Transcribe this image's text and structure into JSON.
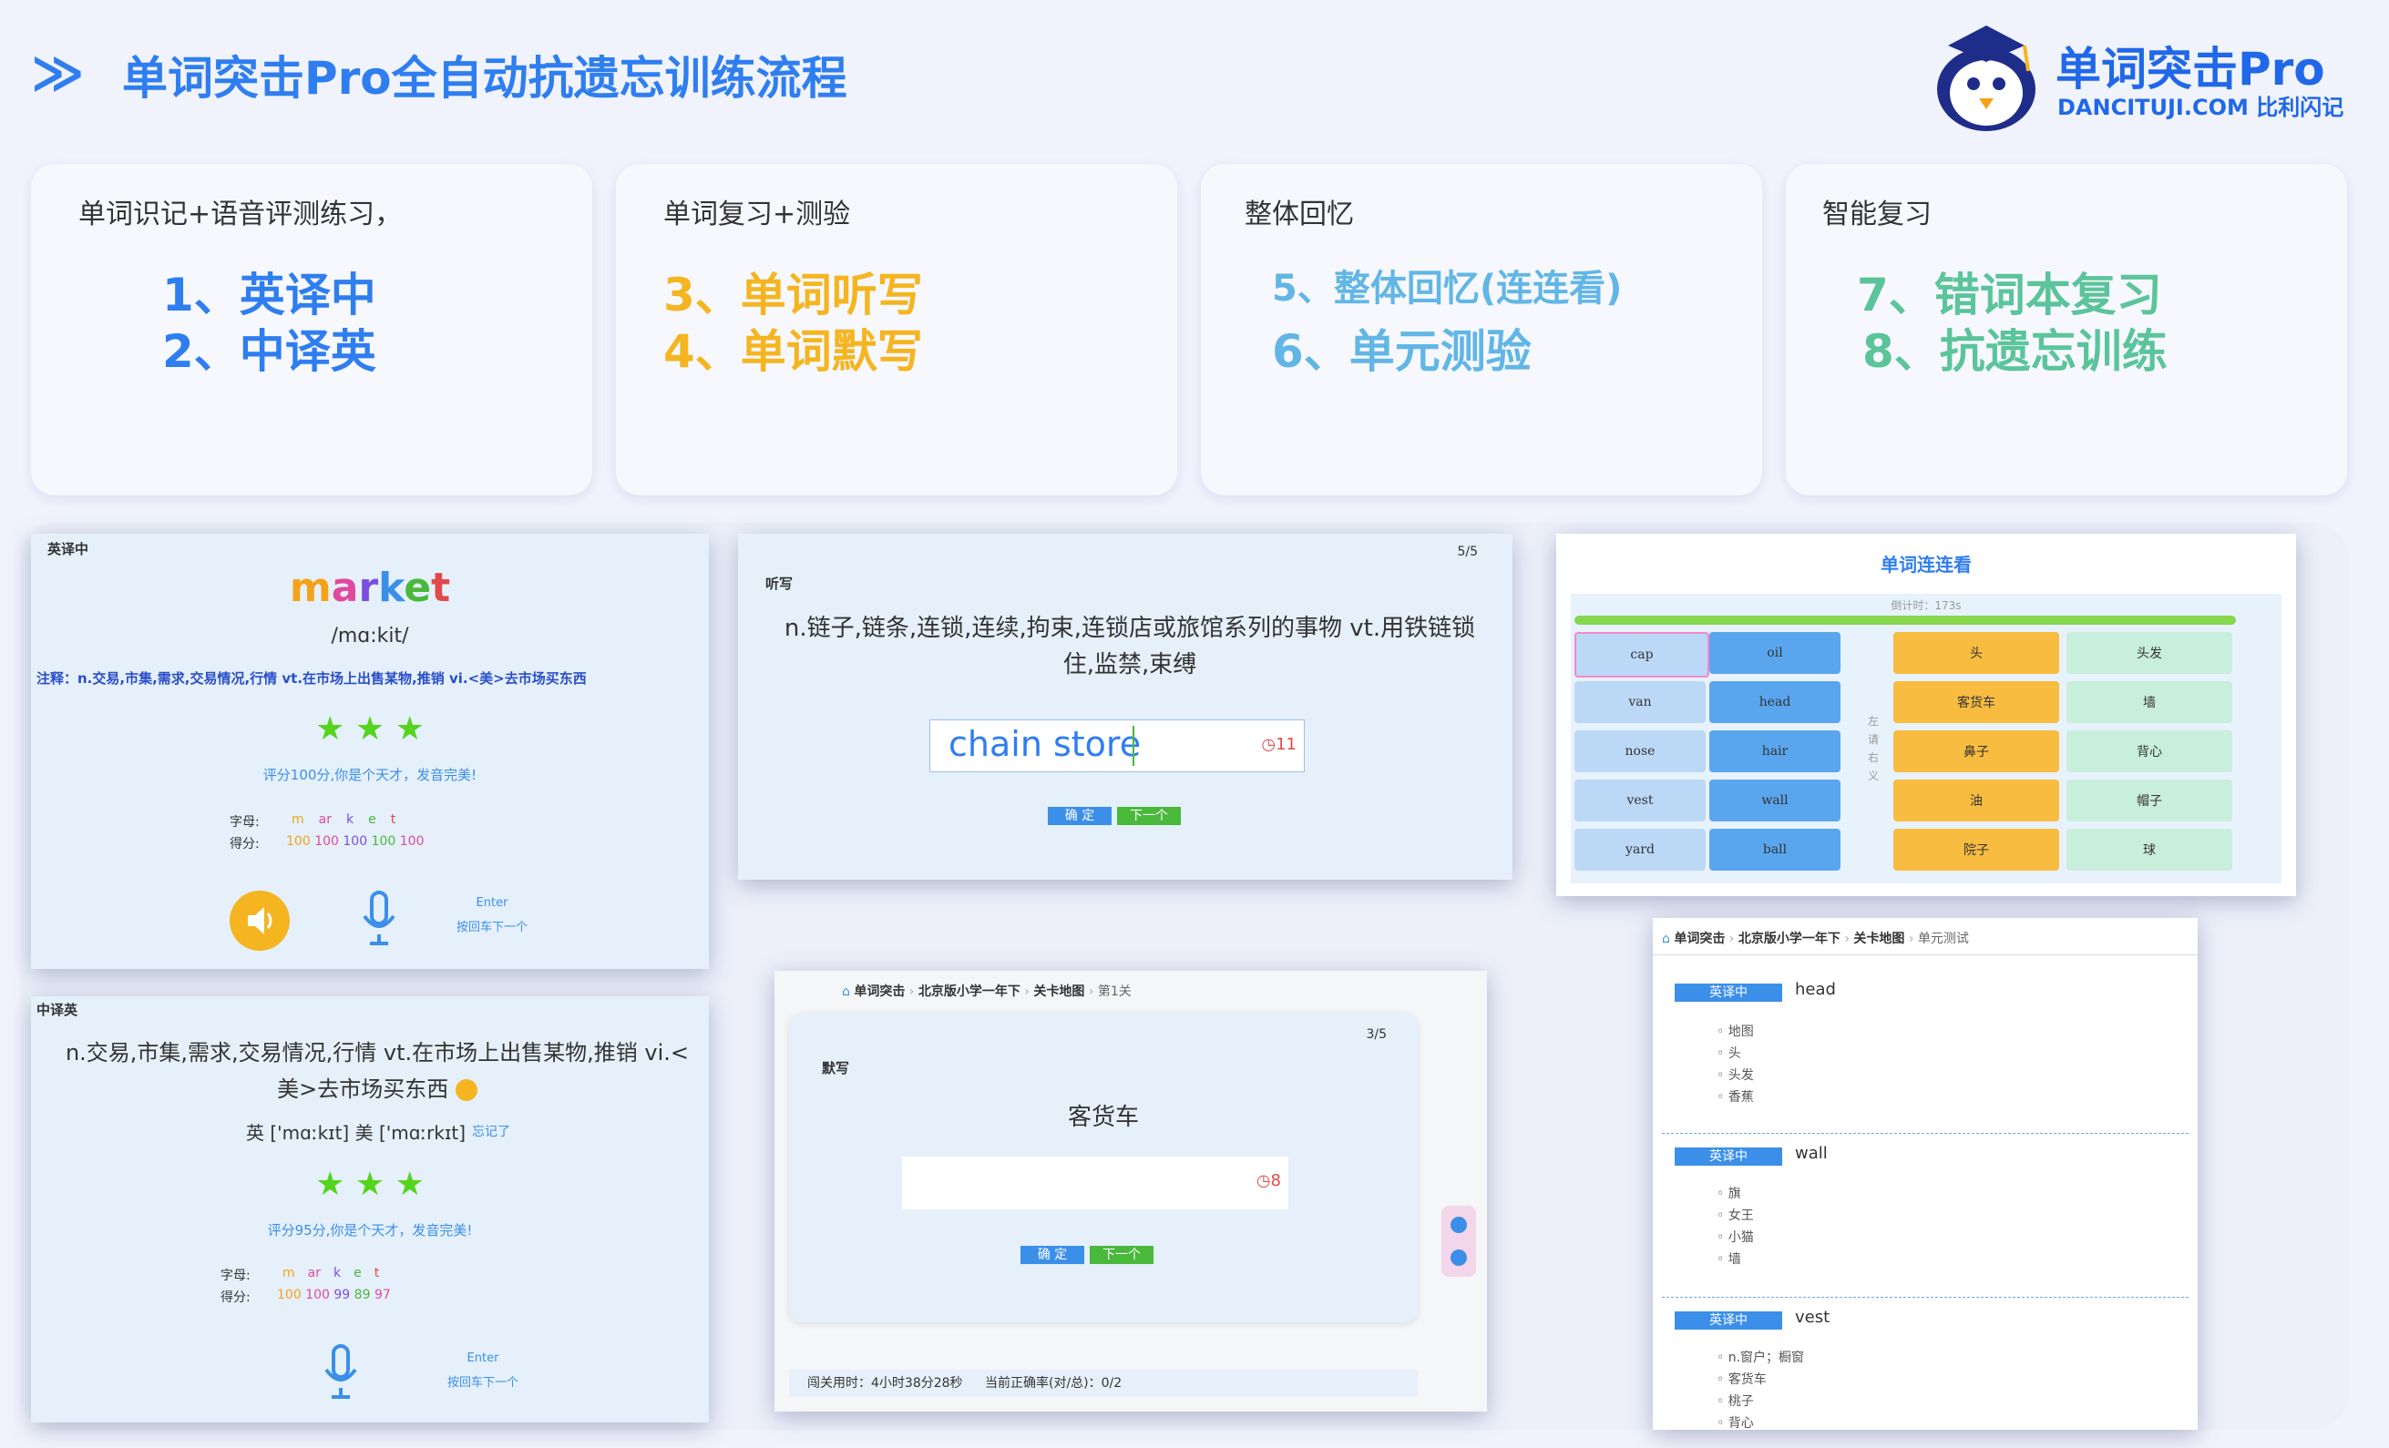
{
  "header": {
    "arrow": "≫",
    "title": "单词突击Pro全自动抗遗忘训练流程",
    "brand_main": "单词突击Pro",
    "brand_sub": "DANCITUJI.COM 比利闪记"
  },
  "colors": {
    "blue": "#2f7ef0",
    "yellow": "#f4b521",
    "sky": "#62b6e6",
    "green": "#5bc49a"
  },
  "cards": [
    {
      "title": "单词识记+语音评测练习，",
      "lines": [
        "1、英译中",
        "2、中译英"
      ]
    },
    {
      "title": "单词复习+测验",
      "lines": [
        "3、单词听写",
        "4、单词默写"
      ]
    },
    {
      "title": "整体回忆",
      "lines": [
        "5、整体回忆(连连看)",
        "6、单元测验"
      ]
    },
    {
      "title": "智能复习",
      "lines": [
        "7、错词本复习",
        "8、抗遗忘训练"
      ]
    }
  ],
  "shot_en2zh": {
    "label": "英译中",
    "word": "market",
    "phonetic": "/mɑ:kit/",
    "note": "注释：n.交易,市集,需求,交易情况,行情 vt.在市场上出售某物,推销 vi.<美>去市场买东西",
    "stars": "★ ★ ★",
    "feedback": "评分100分,你是个天才，发音完美!",
    "letters_label": "字母:",
    "letters": [
      "m",
      "ar",
      "k",
      "e",
      "t"
    ],
    "scores_label": "得分:",
    "scores": [
      "100",
      "100",
      "100",
      "100",
      "100"
    ],
    "enter": "Enter",
    "enter_hint": "按回车下一个"
  },
  "shot_zh2en": {
    "label": "中译英",
    "meaning": "n.交易,市集,需求,交易情况,行情 vt.在市场上出售某物,推销 vi.<美>去市场买东西",
    "phonetic": "英 ['mɑːkɪt] 美 ['mɑːrkɪt]",
    "forgot": "忘记了",
    "stars": "★ ★ ★",
    "feedback": "评分95分,你是个天才，发音完美!",
    "letters_label": "字母:",
    "letters": [
      "m",
      "ar",
      "k",
      "e",
      "t"
    ],
    "scores_label": "得分:",
    "scores": [
      "100",
      "100",
      "99",
      "89",
      "97"
    ],
    "enter": "Enter",
    "enter_hint": "按回车下一个"
  },
  "shot_dictation": {
    "label": "听写",
    "progress": "5/5",
    "meaning": "n.链子,链条,连锁,连续,拘束,连锁店或旅馆系列的事物 vt.用铁链锁住,监禁,束缚",
    "input_value": "chain store",
    "timer": "11",
    "confirm": "确 定",
    "next": "下一个"
  },
  "shot_match": {
    "title": "单词连连看",
    "countdown": "倒计时：173s",
    "side_hint": "左 请 右 义",
    "words_a": [
      "cap",
      "van",
      "nose",
      "vest",
      "yard"
    ],
    "words_b": [
      "oil",
      "head",
      "hair",
      "wall",
      "ball"
    ],
    "meanings_a": [
      "头",
      "客货车",
      "鼻子",
      "油",
      "院子"
    ],
    "meanings_b": [
      "头发",
      "墙",
      "背心",
      "帽子",
      "球"
    ]
  },
  "shot_write": {
    "breadcrumb": [
      "单词突击",
      "北京版小学一年下",
      "关卡地图",
      "第1关"
    ],
    "label": "默写",
    "progress": "3/5",
    "word": "客货车",
    "timer": "8",
    "confirm": "确 定",
    "next": "下一个",
    "footer_time": "闯关用时：4小时38分28秒",
    "footer_acc": "当前正确率(对/总)：0/2"
  },
  "shot_test": {
    "breadcrumb": [
      "单词突击",
      "北京版小学一年下",
      "关卡地图",
      "单元测试"
    ],
    "questions": [
      {
        "tag": "英译中",
        "word": "head",
        "options": [
          "地图",
          "头",
          "头发",
          "香蕉"
        ]
      },
      {
        "tag": "英译中",
        "word": "wall",
        "options": [
          "旗",
          "女王",
          "小猫",
          "墙"
        ]
      },
      {
        "tag": "英译中",
        "word": "vest",
        "options": [
          "n.窗户；橱窗",
          "客货车",
          "桃子",
          "背心"
        ]
      }
    ]
  }
}
